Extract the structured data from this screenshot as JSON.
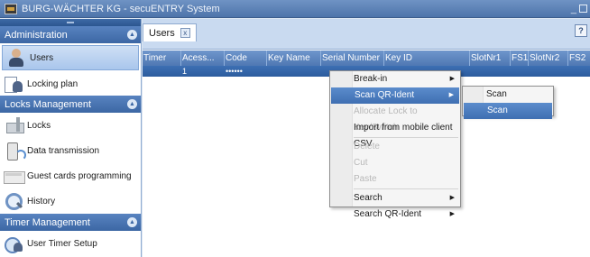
{
  "window": {
    "title": "BURG-WÄCHTER KG - secuENTRY System",
    "app_icon": "safe-icon"
  },
  "sidebar": {
    "sections": [
      {
        "label": "Administration",
        "items": [
          {
            "label": "Users",
            "icon": "user-icon",
            "selected": true
          },
          {
            "label": "Locking plan",
            "icon": "locking-plan-icon"
          }
        ]
      },
      {
        "label": "Locks Management",
        "items": [
          {
            "label": "Locks",
            "icon": "lock-icon"
          },
          {
            "label": "Data transmission",
            "icon": "data-transmission-icon"
          },
          {
            "label": "Guest cards programming",
            "icon": "guest-card-icon"
          },
          {
            "label": "History",
            "icon": "history-icon"
          }
        ]
      },
      {
        "label": "Timer Management",
        "items": [
          {
            "label": "User Timer Setup",
            "icon": "timer-icon"
          }
        ]
      }
    ]
  },
  "tabs": {
    "active": "Users",
    "close_glyph": "x",
    "help_glyph": "?"
  },
  "grid": {
    "columns": [
      "Timer",
      "Acess...",
      "Code",
      "Key Name",
      "Serial Number",
      "Key ID",
      "SlotNr1",
      "FS1",
      "SlotNr2",
      "FS2"
    ],
    "rows": [
      [
        "",
        "1",
        "••••••",
        "",
        "",
        "",
        "",
        "",
        "",
        ""
      ]
    ]
  },
  "context_menu": {
    "items": [
      {
        "label": "Break-in",
        "submenu": true,
        "enabled": true
      },
      {
        "label": "Scan QR-Ident",
        "submenu": true,
        "enabled": true,
        "highlighted": true
      },
      {
        "label": "Allocate Lock to Key/Switch",
        "enabled": false
      },
      {
        "label": "Import from mobile client CSV",
        "enabled": true
      },
      {
        "label": "Delete",
        "enabled": false
      },
      {
        "label": "Cut",
        "enabled": false
      },
      {
        "label": "Paste",
        "enabled": false
      },
      {
        "label": "Search",
        "submenu": true,
        "enabled": true
      },
      {
        "label": "Search QR-Ident",
        "submenu": true,
        "enabled": true
      }
    ],
    "submenu": [
      {
        "label": "Scan Key/Switch",
        "highlighted": false
      },
      {
        "label": "Scan transponder",
        "highlighted": true
      }
    ]
  },
  "colors": {
    "titlebar": "#4e74aa",
    "section_header": "#3c67a4",
    "grid_header": "#4f78b3",
    "menu_highlight": "#3f6fb2"
  }
}
